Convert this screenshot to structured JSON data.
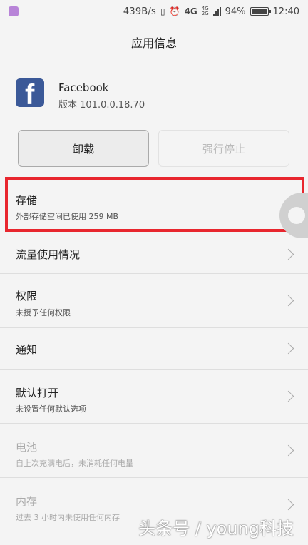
{
  "status_bar": {
    "net_speed": "439B/s",
    "network_top": "4G",
    "network_2": "4G",
    "network_3": "2G",
    "battery": "94%",
    "time": "12:40"
  },
  "title": "应用信息",
  "app": {
    "name": "Facebook",
    "version": "版本 101.0.0.18.70",
    "icon_letter": "f"
  },
  "buttons": {
    "uninstall": "卸载",
    "force_stop": "强行停止"
  },
  "items": [
    {
      "label": "存储",
      "sub": "外部存储空间已使用 259 MB"
    },
    {
      "label": "流量使用情况"
    },
    {
      "label": "权限",
      "sub": "未授予任何权限"
    },
    {
      "label": "通知"
    },
    {
      "label": "默认打开",
      "sub": "未设置任何默认选项"
    },
    {
      "label": "电池",
      "sub": "自上次充满电后，未消耗任何电量"
    },
    {
      "label": "内存",
      "sub": "过去 3 小时内未使用任何内存"
    }
  ],
  "watermark": "头条号 / young科技",
  "colors": {
    "highlight": "#e8262e",
    "facebook_blue": "#3b5998"
  }
}
